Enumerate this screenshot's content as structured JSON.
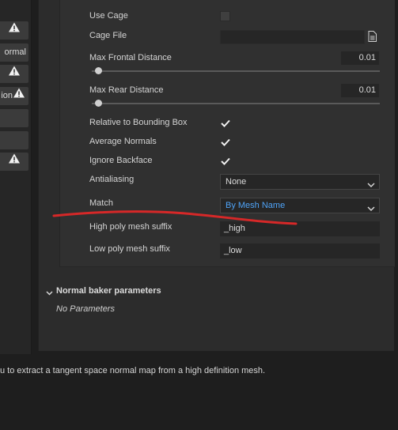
{
  "left_toolbar": {
    "btn_normal": "ormal",
    "btn_position": "ion"
  },
  "properties": {
    "use_cage": {
      "label": "Use Cage",
      "checked": false
    },
    "cage_file": {
      "label": "Cage File",
      "value": ""
    },
    "max_frontal_distance": {
      "label": "Max Frontal Distance",
      "value": "0.01",
      "level": 0.01
    },
    "max_rear_distance": {
      "label": "Max Rear Distance",
      "value": "0.01",
      "level": 0.01
    },
    "relative_to_bounding_box": {
      "label": "Relative to Bounding Box",
      "checked": true
    },
    "average_normals": {
      "label": "Average Normals",
      "checked": true
    },
    "ignore_backface": {
      "label": "Ignore Backface",
      "checked": true
    },
    "antialiasing": {
      "label": "Antialiasing",
      "value": "None"
    },
    "match": {
      "label": "Match",
      "value": "By Mesh Name"
    },
    "high_poly_suffix": {
      "label": "High poly mesh suffix",
      "value": "_high"
    },
    "low_poly_suffix": {
      "label": "Low poly mesh suffix",
      "value": "_low"
    }
  },
  "normal_baker": {
    "title": "Normal baker parameters",
    "empty_text": "No Parameters"
  },
  "footer": {
    "description": "u to extract a tangent space normal map from a high definition mesh."
  },
  "colors": {
    "accent_blue": "#4fa3f7",
    "annotation_red": "#d62828",
    "panel_bg": "#303030"
  },
  "icons": [
    "warning-icon",
    "file-icon",
    "checkmark-icon",
    "chevron-down-icon"
  ]
}
